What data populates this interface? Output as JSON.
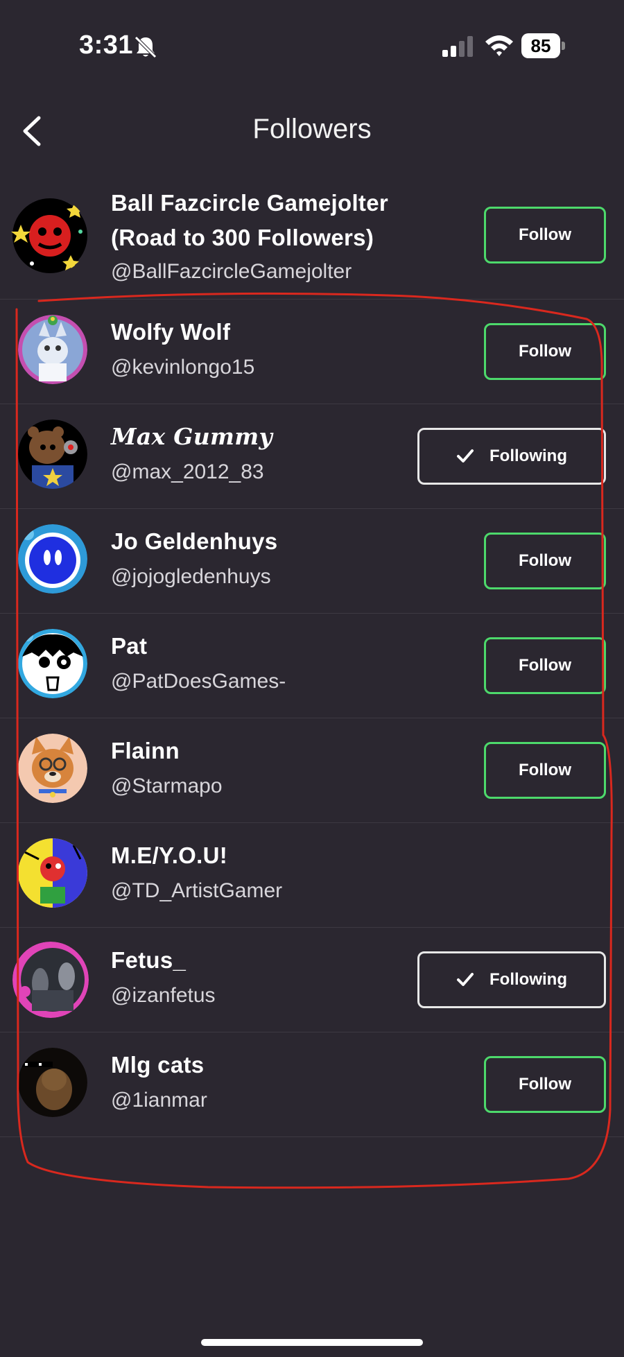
{
  "status_bar": {
    "time": "3:31",
    "battery": "85",
    "icons": [
      "bell-slash-icon",
      "signal-icon",
      "wifi-icon",
      "battery-icon"
    ]
  },
  "header": {
    "title": "Followers",
    "back_icon": "chevron-left-icon"
  },
  "followers": [
    {
      "name_line1": "Ball Fazcircle Gamejolter",
      "name_line2": "(Road to 300 Followers)",
      "handle": "@BallFazcircleGamejolter",
      "button": "Follow"
    },
    {
      "name": "Wolfy Wolf",
      "handle": "@kevinlongo15",
      "button": "Follow"
    },
    {
      "name": "Max Gummy",
      "handle": "@max_2012_83",
      "button": "Following"
    },
    {
      "name": "Jo Geldenhuys",
      "handle": "@jojogledenhuys",
      "button": "Follow"
    },
    {
      "name": "Pat",
      "handle": "@PatDoesGames-",
      "button": "Follow"
    },
    {
      "name": "Flainn",
      "handle": "@Starmapo",
      "button": "Follow"
    },
    {
      "name": "M.E/Y.O.U!",
      "handle": "@TD_ArtistGamer",
      "button": ""
    },
    {
      "name": "Fetus_",
      "handle": "@izanfetus",
      "button": "Following"
    },
    {
      "name": "Mlg cats",
      "handle": "@1ianmar",
      "button": "Follow"
    }
  ],
  "colors": {
    "background": "#2b2730",
    "follow_border": "#4dd96b",
    "following_border": "#e8e8e8",
    "annotation": "#d9281e"
  }
}
